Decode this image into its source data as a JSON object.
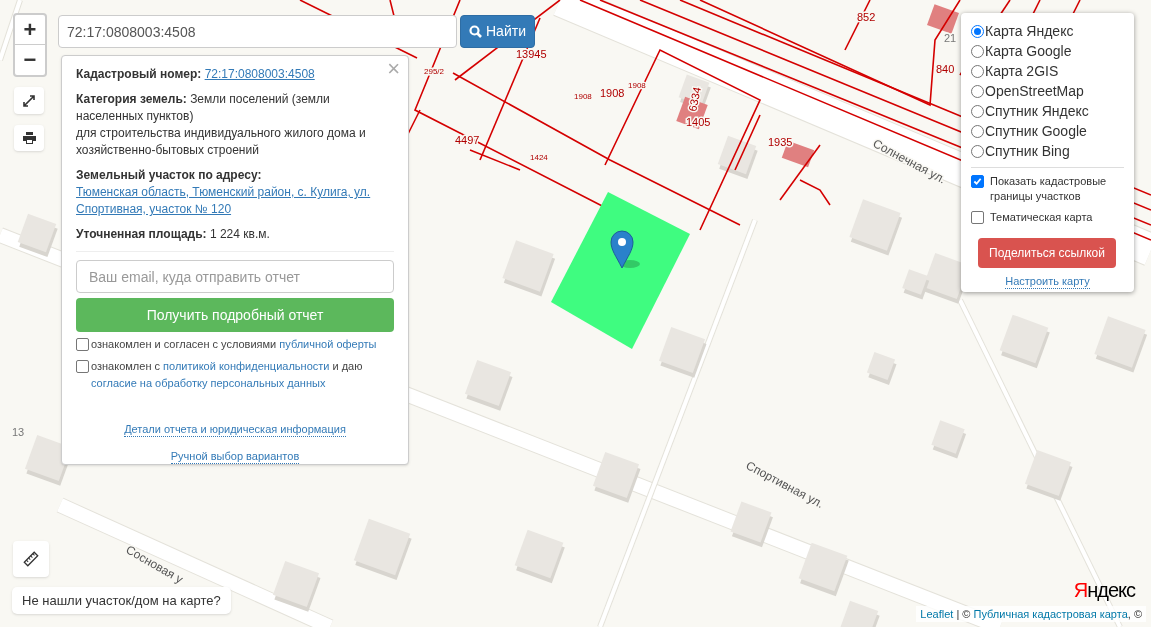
{
  "map_labels": [
    {
      "text": "852",
      "kind": "plot"
    },
    {
      "text": "21",
      "kind": "house"
    },
    {
      "text": "840",
      "kind": "plot"
    },
    {
      "text": "13945",
      "kind": "plot"
    },
    {
      "text": "295/2",
      "kind": "small"
    },
    {
      "text": "1908",
      "kind": "small"
    },
    {
      "text": "1908",
      "kind": "plot"
    },
    {
      "text": "1908",
      "kind": "small"
    },
    {
      "text": "1405",
      "kind": "plot"
    },
    {
      "text": "6334",
      "kind": "plot"
    },
    {
      "text": "4497",
      "kind": "plot"
    },
    {
      "text": "1424",
      "kind": "small"
    },
    {
      "text": "1935",
      "kind": "plot"
    },
    {
      "text": "Солнечная ул.",
      "kind": "street"
    },
    {
      "text": "Спортивная ул.",
      "kind": "street"
    },
    {
      "text": "Сосновая у",
      "kind": "street"
    },
    {
      "text": "13",
      "kind": "house"
    }
  ],
  "zoom": {
    "in": "+",
    "out": "−"
  },
  "search": {
    "value": "72:17:0808003:4508",
    "button": "Найти"
  },
  "popup": {
    "close": "×",
    "cadastral": {
      "label": "Кадастровый номер:",
      "value": "72:17:0808003:4508"
    },
    "category": {
      "label": "Категория земель:",
      "value": "Земли поселений (земли населенных пунктов)",
      "usage": "для строительства индивидуального жилого дома и хозяйственно-бытовых строений"
    },
    "address": {
      "label": "Земельный участок по адресу:",
      "value": "Тюменская область, Тюменский район, с. Кулига, ул. Спортивная, участок № 120"
    },
    "area": {
      "label": "Уточненная площадь:",
      "value": "1 224 кв.м."
    },
    "email": {
      "placeholder": "Ваш email, куда отправить отчет"
    },
    "report_button": "Получить подробный отчет",
    "agreements": [
      {
        "checked": false,
        "parts": [
          {
            "kind": "text",
            "text": "ознакомлен и согласен с условиями "
          },
          {
            "kind": "link",
            "text": "публичной оферты"
          }
        ]
      },
      {
        "checked": false,
        "parts": [
          {
            "kind": "text",
            "text": "ознакомлен с "
          },
          {
            "kind": "link",
            "text": "политикой конфиденциальности"
          },
          {
            "kind": "text",
            "text": " и даю "
          },
          {
            "kind": "link",
            "text": "согласие на обработку персональных данных"
          }
        ]
      }
    ],
    "links": [
      "Детали отчета и юридическая информация",
      "Ручной выбор вариантов"
    ]
  },
  "layers": {
    "base": [
      {
        "label": "Карта Яндекс",
        "selected": true
      },
      {
        "label": "Карта Google",
        "selected": false
      },
      {
        "label": "Карта 2GIS",
        "selected": false
      },
      {
        "label": "OpenStreetMap",
        "selected": false
      },
      {
        "label": "Спутник Яндекс",
        "selected": false
      },
      {
        "label": "Спутник Google",
        "selected": false
      },
      {
        "label": "Спутник Bing",
        "selected": false
      }
    ],
    "overlays": [
      {
        "label": "Показать кадастровые границы участков",
        "checked": true
      },
      {
        "label": "Тематическая карта",
        "checked": false
      }
    ],
    "share_button": "Поделиться ссылкой",
    "settings_link": "Настроить карту"
  },
  "not_found_button": "Не нашли участок/дом на карте?",
  "logo": "Яндекс",
  "attribution": [
    {
      "kind": "link",
      "text": "Leaflet"
    },
    {
      "kind": "text",
      "text": " | © "
    },
    {
      "kind": "link",
      "text": "Публичная кадастровая карта"
    },
    {
      "kind": "text",
      "text": ", ©"
    }
  ]
}
